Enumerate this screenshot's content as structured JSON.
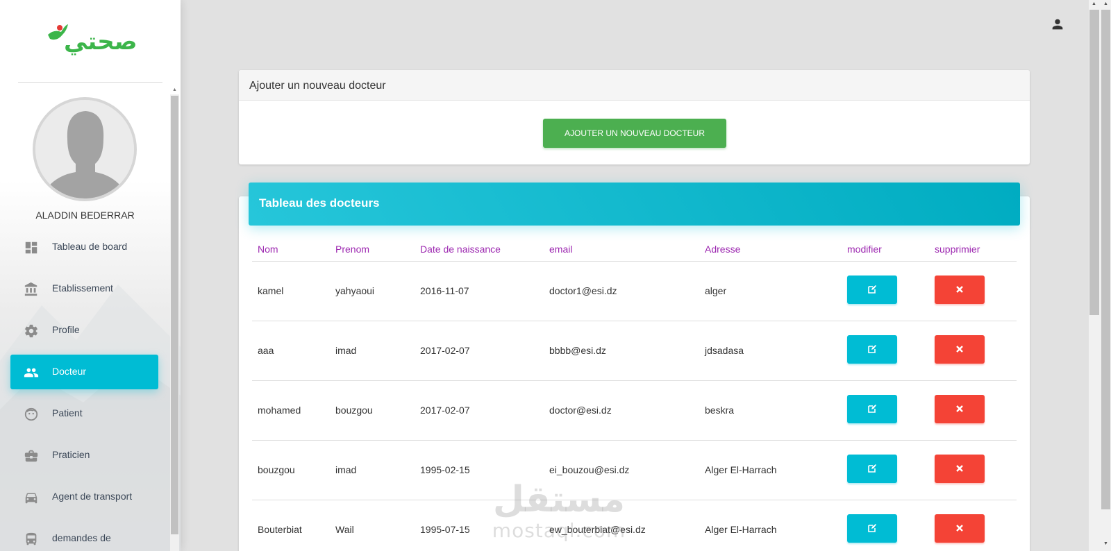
{
  "brand": {
    "logo_text": "صحتي"
  },
  "user": {
    "name": "ALADDIN BEDERRAR"
  },
  "sidebar": {
    "items": [
      {
        "label": "Tableau de board",
        "icon": "dashboard-icon",
        "active": false
      },
      {
        "label": "Etablissement",
        "icon": "bank-icon",
        "active": false
      },
      {
        "label": "Profile",
        "icon": "gear-icon",
        "active": false
      },
      {
        "label": "Docteur",
        "icon": "people-icon",
        "active": true
      },
      {
        "label": "Patient",
        "icon": "face-icon",
        "active": false
      },
      {
        "label": "Praticien",
        "icon": "briefcase-icon",
        "active": false
      },
      {
        "label": "Agent de transport",
        "icon": "car-icon",
        "active": false
      },
      {
        "label": "demandes de",
        "icon": "bus-icon",
        "active": false
      }
    ]
  },
  "add_card": {
    "title": "Ajouter un nouveau docteur",
    "button_label": "AJOUTER UN NOUVEAU DOCTEUR"
  },
  "table_card": {
    "title": "Tableau des docteurs",
    "columns": [
      "Nom",
      "Prenom",
      "Date de naissance",
      "email",
      "Adresse",
      "modifier",
      "supprimier"
    ],
    "rows": [
      {
        "nom": "kamel",
        "prenom": "yahyaoui",
        "date": "2016-11-07",
        "email": "doctor1@esi.dz",
        "adresse": "alger"
      },
      {
        "nom": "aaa",
        "prenom": "imad",
        "date": "2017-02-07",
        "email": "bbbb@esi.dz",
        "adresse": "jdsadasa"
      },
      {
        "nom": "mohamed",
        "prenom": "bouzgou",
        "date": "2017-02-07",
        "email": "doctor@esi.dz",
        "adresse": "beskra"
      },
      {
        "nom": "bouzgou",
        "prenom": "imad",
        "date": "1995-02-15",
        "email": "ei_bouzou@esi.dz",
        "adresse": "Alger El-Harrach"
      },
      {
        "nom": "Bouterbiat",
        "prenom": "Wail",
        "date": "1995-07-15",
        "email": "ew_bouterbiat@esi.dz",
        "adresse": "Alger El-Harrach"
      }
    ]
  },
  "watermark": {
    "arabic": "مستقل",
    "latin": "mostaql.com"
  },
  "colors": {
    "accent": "#00bcd4",
    "success": "#4caf50",
    "danger": "#f44336",
    "header_text": "#9c27b0",
    "brand_green": "#3cb54a"
  }
}
